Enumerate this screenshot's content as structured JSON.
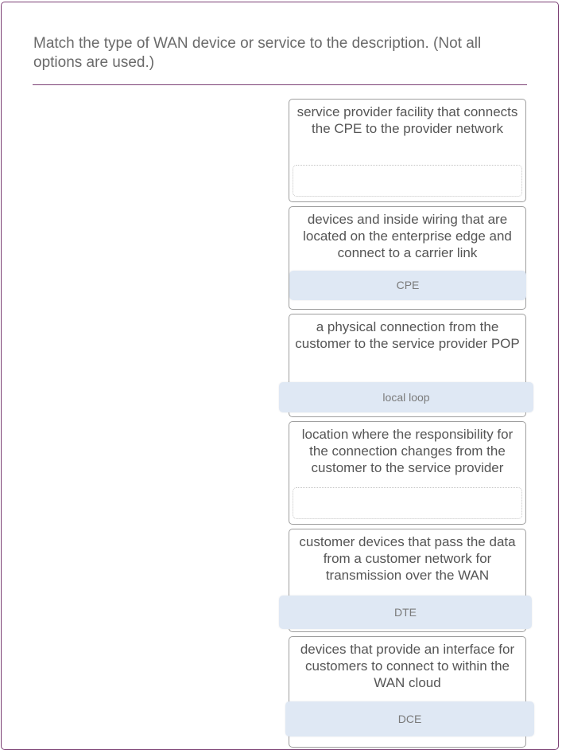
{
  "question": {
    "prompt": "Match the type of WAN device or service to the description. (Not all options are used.)"
  },
  "targets": [
    {
      "description": "service provider facility that connects the CPE to the provider network",
      "answer": ""
    },
    {
      "description": "devices and inside wiring that are located on the enterprise edge and connect to a carrier link",
      "answer": "CPE"
    },
    {
      "description": "a physical connection from the customer to the service provider POP",
      "answer": "local loop"
    },
    {
      "description": "location where the responsibility for the connection changes from the customer to the service provider",
      "answer": ""
    },
    {
      "description": "customer devices that pass the data from a customer network for transmission over the WAN",
      "answer": "DTE"
    },
    {
      "description": "devices that provide an interface for customers to connect to within the WAN cloud",
      "answer": "DCE"
    }
  ],
  "colors": {
    "accent_border": "#7b3f74",
    "chip_background": "#dfe8f4",
    "text": "#555555"
  }
}
